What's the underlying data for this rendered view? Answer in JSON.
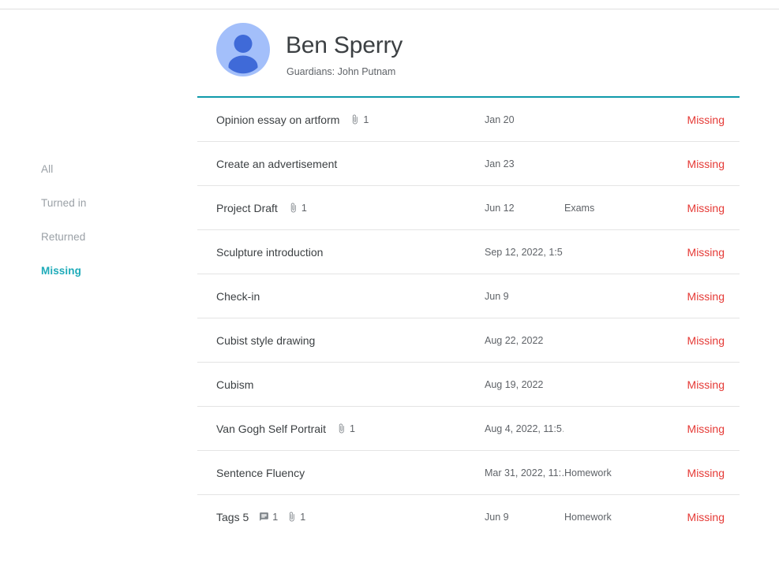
{
  "sidebar": {
    "items": [
      {
        "label": "All",
        "active": false
      },
      {
        "label": "Turned in",
        "active": false
      },
      {
        "label": "Returned",
        "active": false
      },
      {
        "label": "Missing",
        "active": true
      }
    ]
  },
  "header": {
    "student_name": "Ben Sperry",
    "guardians": "Guardians: John Putnam",
    "avatar_icon": "person-avatar-icon",
    "avatar_bg_color": "#a3bffa",
    "avatar_fg_color": "#3f6ad8",
    "divider_color": "#0f9aaa"
  },
  "colors": {
    "accent_teal": "#1eabb9",
    "status_missing": "#e53935",
    "muted_text": "#5f6368",
    "title_text": "#3c4043"
  },
  "assignments": [
    {
      "title": "Opinion essay on artform",
      "comments": null,
      "attachments": "1",
      "date": "Jan 20",
      "category": "",
      "status": "Missing"
    },
    {
      "title": "Create an advertisement",
      "comments": null,
      "attachments": null,
      "date": "Jan 23",
      "category": "",
      "status": "Missing"
    },
    {
      "title": "Project Draft",
      "comments": null,
      "attachments": "1",
      "date": "Jun 12",
      "category": "Exams",
      "status": "Missing"
    },
    {
      "title": "Sculpture introduction",
      "comments": null,
      "attachments": null,
      "date": "Sep 12, 2022, 1:5…",
      "category": "",
      "status": "Missing"
    },
    {
      "title": "Check-in",
      "comments": null,
      "attachments": null,
      "date": "Jun 9",
      "category": "",
      "status": "Missing"
    },
    {
      "title": "Cubist style drawing",
      "comments": null,
      "attachments": null,
      "date": "Aug 22, 2022",
      "category": "",
      "status": "Missing"
    },
    {
      "title": "Cubism",
      "comments": null,
      "attachments": null,
      "date": "Aug 19, 2022",
      "category": "",
      "status": "Missing"
    },
    {
      "title": "Van Gogh Self Portrait",
      "comments": null,
      "attachments": "1",
      "date": "Aug 4, 2022, 11:5…",
      "category": "",
      "status": "Missing"
    },
    {
      "title": "Sentence Fluency",
      "comments": null,
      "attachments": null,
      "date": "Mar 31, 2022, 11:…",
      "category": "Homework",
      "status": "Missing"
    },
    {
      "title": "Tags 5",
      "comments": "1",
      "attachments": "1",
      "date": "Jun 9",
      "category": "Homework",
      "status": "Missing"
    }
  ]
}
